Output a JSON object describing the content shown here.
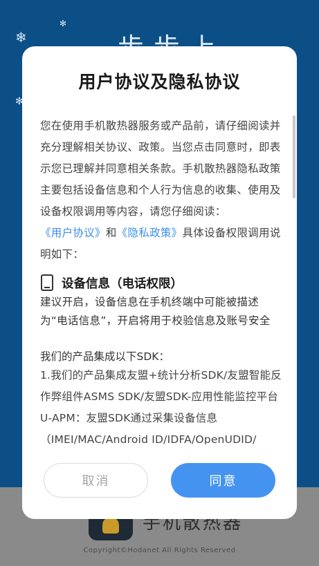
{
  "background": {
    "title": "步步上",
    "app_name": "手机散热器",
    "copyright": "Copyright©Hodanet All Rights Reserved"
  },
  "dialog": {
    "title": "用户协议及隐私协议",
    "intro_text": "您在使用手机散热器服务或产品前，请仔细阅读并充分理解相关协议、政策。当您点击同意时，即表示您已理解并同意相关条款。手机散热器隐私政策主要包括设备信息和个人行为信息的收集、使用及设备权限调用等内容，请您仔细阅读：",
    "link_user_agreement": "《用户协议》",
    "and_text": "和",
    "link_privacy_policy": "《隐私政策》",
    "intro_tail": "具体设备权限调用说明如下：",
    "permission": {
      "title": "设备信息（电话权限）",
      "desc": "建议开启，设备信息在手机终端中可能被描述为“电话信息”，开启将用于校验信息及账号安全"
    },
    "sdk_heading": "我们的产品集成以下SDK：",
    "sdk_text": "1.我们的产品集成友盟+统计分析SDK/友盟智能反作弊组件ASMS SDK/友盟SDK-应用性能监控平台U-APM：友盟SDK通过采集设备信息（IMEI/MAC/Android ID/IDFA/OpenUDID/",
    "cancel_label": "取消",
    "agree_label": "同意"
  },
  "colors": {
    "background_blue": "#0b4f86",
    "link": "#3a8ee6",
    "agree_button": "#4593f1"
  }
}
